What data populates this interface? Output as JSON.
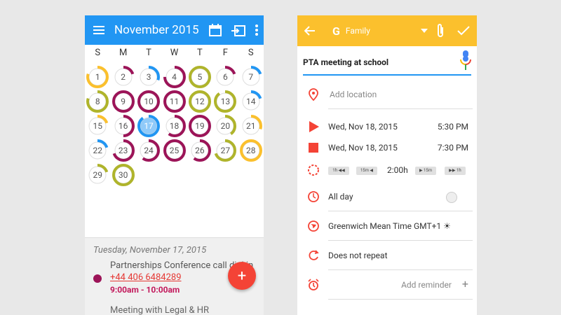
{
  "left": {
    "title": "November 2015",
    "weekdays": [
      "S",
      "M",
      "T",
      "W",
      "T",
      "F",
      "S"
    ],
    "days": [
      "1",
      "2",
      "3",
      "4",
      "5",
      "6",
      "7",
      "8",
      "9",
      "10",
      "11",
      "12",
      "13",
      "14",
      "15",
      "16",
      "17",
      "18",
      "19",
      "20",
      "21",
      "22",
      "23",
      "24",
      "25",
      "26",
      "27",
      "28",
      "29",
      "30"
    ],
    "agenda_date": "Tuesday, November 17, 2015",
    "event1_title": "Partnerships Conference call dial in",
    "event1_phone": "+44 406 6484289",
    "event1_time": "9:00am - 10:00am",
    "event2_title": "Meeting with Legal & HR",
    "fab": "+"
  },
  "right": {
    "calendar_name": "Family",
    "title_value": "PTA meeting at school",
    "location_placeholder": "Add location",
    "start_date": "Wed, Nov 18, 2015",
    "start_time": "5:30 PM",
    "end_date": "Wed, Nov 18, 2015",
    "end_time": "7:30 PM",
    "duration": "2:00h",
    "dur_btns": [
      "1h ◀◀",
      "15m ◀",
      "▶ 15m",
      "▶▶ 1h"
    ],
    "allday": "All day",
    "timezone": "Greenwich Mean Time GMT+1 ☀",
    "repeat": "Does not repeat",
    "reminder": "Add reminder",
    "plus": "+"
  },
  "colors": {
    "blue": "#2196f3",
    "yellow": "#fbc02d",
    "crimson": "#9c1458",
    "lime": "#afb42b",
    "red": "#f44336"
  }
}
